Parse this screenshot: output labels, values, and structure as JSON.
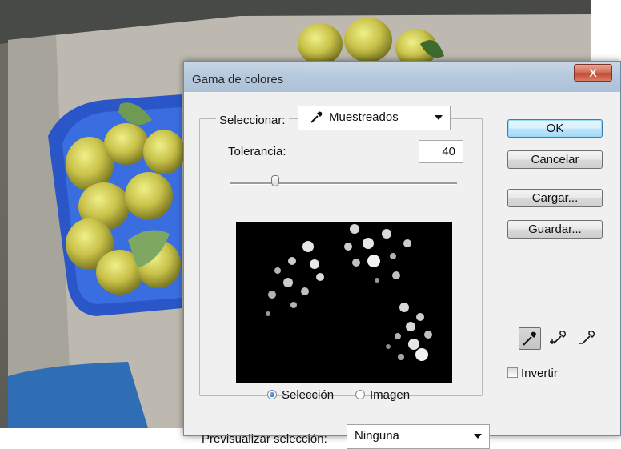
{
  "dialog": {
    "title": "Gama de colores",
    "close_label": "X"
  },
  "select_group": {
    "seleccionar_label": "Seleccionar:",
    "seleccionar_value": "Muestreados",
    "tolerancia_label": "Tolerancia:",
    "tolerancia_value": "40",
    "tolerancia_slider_fraction": 0.2
  },
  "preview_mode": {
    "options": [
      "Selección",
      "Imagen"
    ],
    "selected": "Selección"
  },
  "previsualizar": {
    "label": "Previsualizar selección:",
    "value": "Ninguna"
  },
  "buttons": {
    "ok": "OK",
    "cancel": "Cancelar",
    "load": "Cargar...",
    "save": "Guardar..."
  },
  "tools": [
    "eyedropper-icon",
    "eyedropper-plus-icon",
    "eyedropper-minus-icon"
  ],
  "invertir": {
    "label": "Invertir",
    "checked": false
  },
  "colors": {
    "title_bar": "#b3c7dc",
    "close_button": "#c0422a",
    "default_button_border": "#3c7fb1",
    "dialog_bg": "#f0f0f0"
  }
}
